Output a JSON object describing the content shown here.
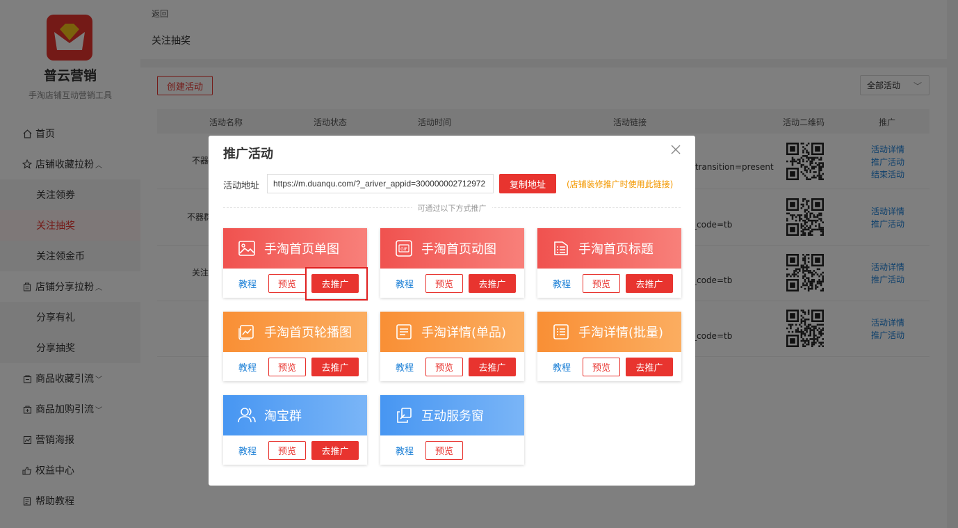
{
  "sidebar": {
    "brand": "普云营销",
    "tagline": "手淘店铺互动营销工具",
    "items": [
      {
        "label": "首页",
        "icon": "home-icon"
      },
      {
        "label": "店铺收藏拉粉",
        "icon": "star-icon",
        "expanded": true
      },
      {
        "label": "关注领券",
        "sub": true
      },
      {
        "label": "关注抽奖",
        "sub": true,
        "active": true
      },
      {
        "label": "关注领金币",
        "sub": true
      },
      {
        "label": "店铺分享拉粉",
        "icon": "share-icon",
        "expanded": true
      },
      {
        "label": "分享有礼",
        "sub": true
      },
      {
        "label": "分享抽奖",
        "sub": true
      },
      {
        "label": "商品收藏引流",
        "icon": "bag-icon"
      },
      {
        "label": "商品加购引流",
        "icon": "cart-icon"
      },
      {
        "label": "营销海报",
        "icon": "poster-icon"
      },
      {
        "label": "权益中心",
        "icon": "rights-icon"
      },
      {
        "label": "帮助教程",
        "icon": "help-icon"
      }
    ]
  },
  "header": {
    "back": "返回",
    "crumb": "关注抽奖"
  },
  "toolbar": {
    "create": "创建活动",
    "filter": "全部活动"
  },
  "table": {
    "columns": [
      "活动名称",
      "活动状态",
      "活动时间",
      "活动链接",
      "活动二维码",
      "推广"
    ],
    "rows": [
      {
        "name": "不器",
        "link": ".transition=present",
        "actions": [
          "活动详情",
          "推广活动",
          "结束活动"
        ]
      },
      {
        "name": "不器群",
        "link": "_code=tb",
        "actions": [
          "活动详情",
          "推广活动"
        ]
      },
      {
        "name": "关注",
        "link": "_code=tb",
        "actions": [
          "活动详情",
          "推广活动"
        ]
      },
      {
        "name": "",
        "link": "_code=tb",
        "actions": [
          "活动详情",
          "推广活动"
        ]
      }
    ]
  },
  "modal": {
    "title": "推广活动",
    "address_label": "活动地址",
    "address_value": "https://m.duanqu.com/?_ariver_appid=300000002712972",
    "copy": "复制地址",
    "hint": "(店铺装修推广时使用此链接)",
    "divider": "可通过以下方式推广",
    "cards": [
      {
        "title": "手淘首页单图",
        "icon": "image-icon",
        "color": "red",
        "tutorial": "教程",
        "preview": "预览",
        "promote": "去推广"
      },
      {
        "title": "手淘首页动图",
        "icon": "gif-icon",
        "color": "red",
        "tutorial": "教程",
        "preview": "预览",
        "promote": "去推广"
      },
      {
        "title": "手淘首页标题",
        "icon": "list-icon",
        "color": "red",
        "tutorial": "教程",
        "preview": "预览",
        "promote": "去推广"
      },
      {
        "title": "手淘首页轮播图",
        "icon": "carousel-icon",
        "color": "orange",
        "tutorial": "教程",
        "preview": "预览",
        "promote": "去推广"
      },
      {
        "title": "手淘详情(单品)",
        "icon": "doc-icon",
        "color": "orange",
        "tutorial": "教程",
        "preview": "预览",
        "promote": "去推广"
      },
      {
        "title": "手淘详情(批量)",
        "icon": "doc-list-icon",
        "color": "orange",
        "tutorial": "教程",
        "preview": "预览",
        "promote": "去推广"
      },
      {
        "title": "淘宝群",
        "icon": "group-icon",
        "color": "blue",
        "tutorial": "教程",
        "preview": "预览",
        "promote": "去推广"
      },
      {
        "title": "互动服务窗",
        "icon": "window-icon",
        "color": "blue",
        "tutorial": "教程",
        "preview": "预览"
      }
    ]
  },
  "colors": {
    "accent": "#e8342f",
    "link": "#1a7fd6",
    "hint": "#f39800"
  }
}
